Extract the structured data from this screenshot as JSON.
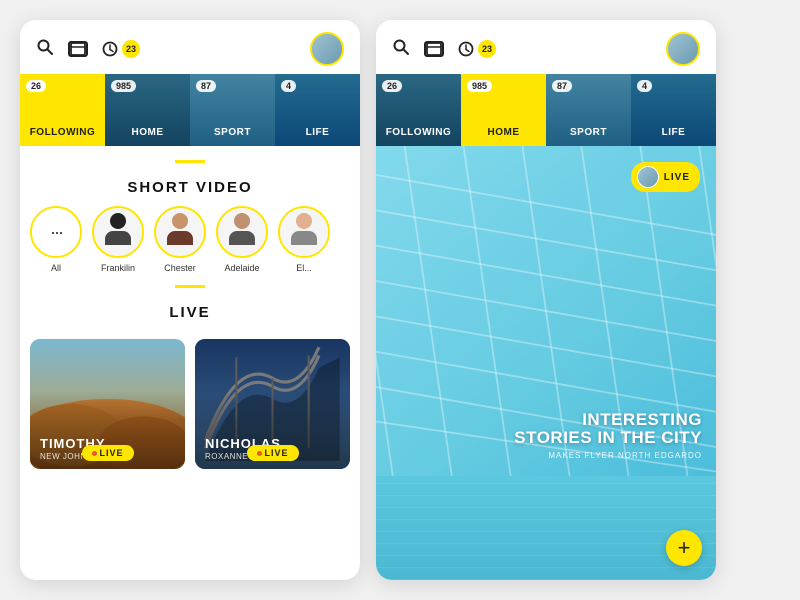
{
  "panels": {
    "left": {
      "header": {
        "badge_count": "23",
        "avatar_alt": "user avatar"
      },
      "tabs": [
        {
          "id": "following",
          "label": "FOLLOWING",
          "count": "26",
          "active": true,
          "has_bg": false,
          "bg_color": "#FFE600"
        },
        {
          "id": "home",
          "label": "HOME",
          "count": "985",
          "active": false,
          "has_bg": true
        },
        {
          "id": "sport",
          "label": "SPORT",
          "count": "87",
          "active": false,
          "has_bg": true
        },
        {
          "id": "life",
          "label": "LIFE",
          "count": "4",
          "active": false,
          "has_bg": true
        }
      ],
      "short_video": {
        "title": "SHORT VIDEO",
        "stories": [
          {
            "id": "all",
            "name": "All",
            "type": "dots"
          },
          {
            "id": "frankilin",
            "name": "Frankilin",
            "type": "person",
            "hair": "#222",
            "skin": "#d4a882"
          },
          {
            "id": "chester",
            "name": "Chester",
            "type": "person",
            "hair": "#6b3a2a",
            "skin": "#c8956a"
          },
          {
            "id": "adelaide",
            "name": "Adelaide",
            "type": "person",
            "hair": "#333",
            "skin": "#c09070"
          },
          {
            "id": "el",
            "name": "El...",
            "type": "person",
            "hair": "#555",
            "skin": "#e0b090"
          }
        ]
      },
      "live": {
        "title": "LIVE",
        "cards": [
          {
            "id": "timothy",
            "name": "TIMOTHY",
            "sub": "NEW JOHNNIE",
            "badge": "LIVE",
            "bg": "desert"
          },
          {
            "id": "nicholas",
            "name": "NICHOLAS",
            "sub": "ROXANNEGIAN",
            "badge": "LIVE",
            "bg": "rollercoaster"
          }
        ]
      }
    },
    "right": {
      "header": {
        "badge_count": "23"
      },
      "tabs": [
        {
          "id": "following",
          "label": "FOLLOWING",
          "count": "26",
          "active": false,
          "has_bg": true
        },
        {
          "id": "home",
          "label": "HOME",
          "count": "985",
          "active": false,
          "has_bg": false,
          "bg_color": "#FFE600"
        },
        {
          "id": "sport",
          "label": "SPORT",
          "count": "87",
          "active": false,
          "has_bg": true
        },
        {
          "id": "life",
          "label": "LIFE",
          "count": "4",
          "active": false,
          "has_bg": true
        }
      ],
      "live_badge": {
        "label": "LIVE"
      },
      "caption": {
        "title": "INTERESTING\nSTORIES IN THE CITY",
        "sub": "MAKES FLYER   NORTH EDGARDO"
      },
      "add_button": "+"
    }
  }
}
